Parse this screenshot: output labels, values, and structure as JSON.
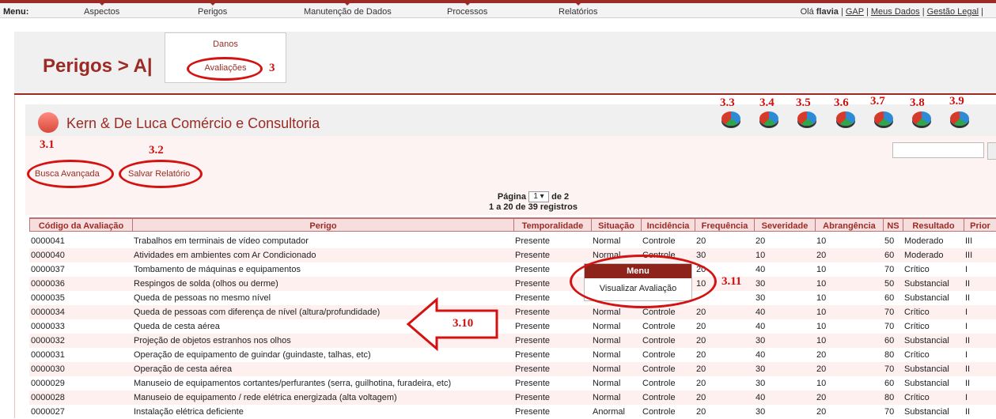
{
  "menu": {
    "label": "Menu:",
    "items": [
      "Aspectos",
      "Perigos",
      "Manutenção de Dados",
      "Processos",
      "Relatórios"
    ]
  },
  "user": {
    "greeting": "Olá",
    "name": "flavia",
    "links": [
      "GAP",
      "Meus Dados",
      "Gestão Legal"
    ]
  },
  "dropdown": {
    "items": [
      "Danos",
      "Avaliações"
    ]
  },
  "page_title": "Perigos > A|",
  "company": "Kern & De Luca Comércio e Consultoria",
  "buttons": {
    "busca": "Busca Avançada",
    "salvar": "Salvar Relatório"
  },
  "pager": {
    "page_prefix": "Página",
    "page_value": "1",
    "page_suffix": "de 2",
    "records": "1 a 20 de 39 registros"
  },
  "context_menu": {
    "title": "Menu",
    "item": "Visualizar Avaliação"
  },
  "annotations": {
    "a3": "3",
    "a31": "3.1",
    "a32": "3.2",
    "a33": "3.3",
    "a34": "3.4",
    "a35": "3.5",
    "a36": "3.6",
    "a37": "3.7",
    "a38": "3.8",
    "a39": "3.9",
    "a310": "3.10",
    "a311": "3.11"
  },
  "colors": {
    "accent": "#9b2b24",
    "annotation": "#d41212"
  },
  "table": {
    "headers": [
      "Código da Avaliação",
      "Perigo",
      "Temporalidade",
      "Situação",
      "Incidência",
      "Frequência",
      "Severidade",
      "Abrangência",
      "NS",
      "Resultado",
      "Prior"
    ],
    "rows": [
      [
        "0000041",
        "Trabalhos em terminais de vídeo computador",
        "Presente",
        "Normal",
        "Controle",
        "20",
        "20",
        "10",
        "50",
        "Moderado",
        "III"
      ],
      [
        "0000040",
        "Atividades em ambientes com Ar Condicionado",
        "Presente",
        "Normal",
        "Controle",
        "30",
        "10",
        "20",
        "60",
        "Moderado",
        "III"
      ],
      [
        "0000037",
        "Tombamento de máquinas e equipamentos",
        "Presente",
        "",
        "",
        "20",
        "40",
        "10",
        "70",
        "Crítico",
        "I"
      ],
      [
        "0000036",
        "Respingos de solda (olhos ou derme)",
        "Presente",
        "",
        "",
        "10",
        "30",
        "10",
        "50",
        "Substancial",
        "II"
      ],
      [
        "0000035",
        "Queda de pessoas no mesmo nível",
        "Presente",
        "",
        "",
        "",
        "30",
        "10",
        "60",
        "Substancial",
        "II"
      ],
      [
        "0000034",
        "Queda de pessoas com diferença de nível (altura/profundidade)",
        "Presente",
        "Normal",
        "Controle",
        "20",
        "40",
        "10",
        "70",
        "Crítico",
        "I"
      ],
      [
        "0000033",
        "Queda de cesta aérea",
        "Presente",
        "Normal",
        "Controle",
        "20",
        "40",
        "10",
        "70",
        "Crítico",
        "I"
      ],
      [
        "0000032",
        "Projeção de objetos estranhos nos olhos",
        "Presente",
        "Normal",
        "Controle",
        "20",
        "30",
        "10",
        "60",
        "Substancial",
        "II"
      ],
      [
        "0000031",
        "Operação de equipamento de guindar (guindaste, talhas, etc)",
        "Presente",
        "Normal",
        "Controle",
        "20",
        "40",
        "20",
        "80",
        "Crítico",
        "I"
      ],
      [
        "0000030",
        "Operação de cesta aérea",
        "Presente",
        "Normal",
        "Controle",
        "20",
        "30",
        "20",
        "70",
        "Substancial",
        "II"
      ],
      [
        "0000029",
        "Manuseio de equipamentos cortantes/perfurantes (serra, guilhotina, furadeira, etc)",
        "Presente",
        "Normal",
        "Controle",
        "20",
        "30",
        "10",
        "60",
        "Substancial",
        "II"
      ],
      [
        "0000028",
        "Manuseio de equipamento / rede elétrica energizada (alta voltagem)",
        "Presente",
        "Normal",
        "Controle",
        "20",
        "40",
        "20",
        "80",
        "Crítico",
        "I"
      ],
      [
        "0000027",
        "Instalação elétrica deficiente",
        "Presente",
        "Anormal",
        "Controle",
        "20",
        "30",
        "20",
        "70",
        "Substancial",
        "II"
      ]
    ]
  }
}
